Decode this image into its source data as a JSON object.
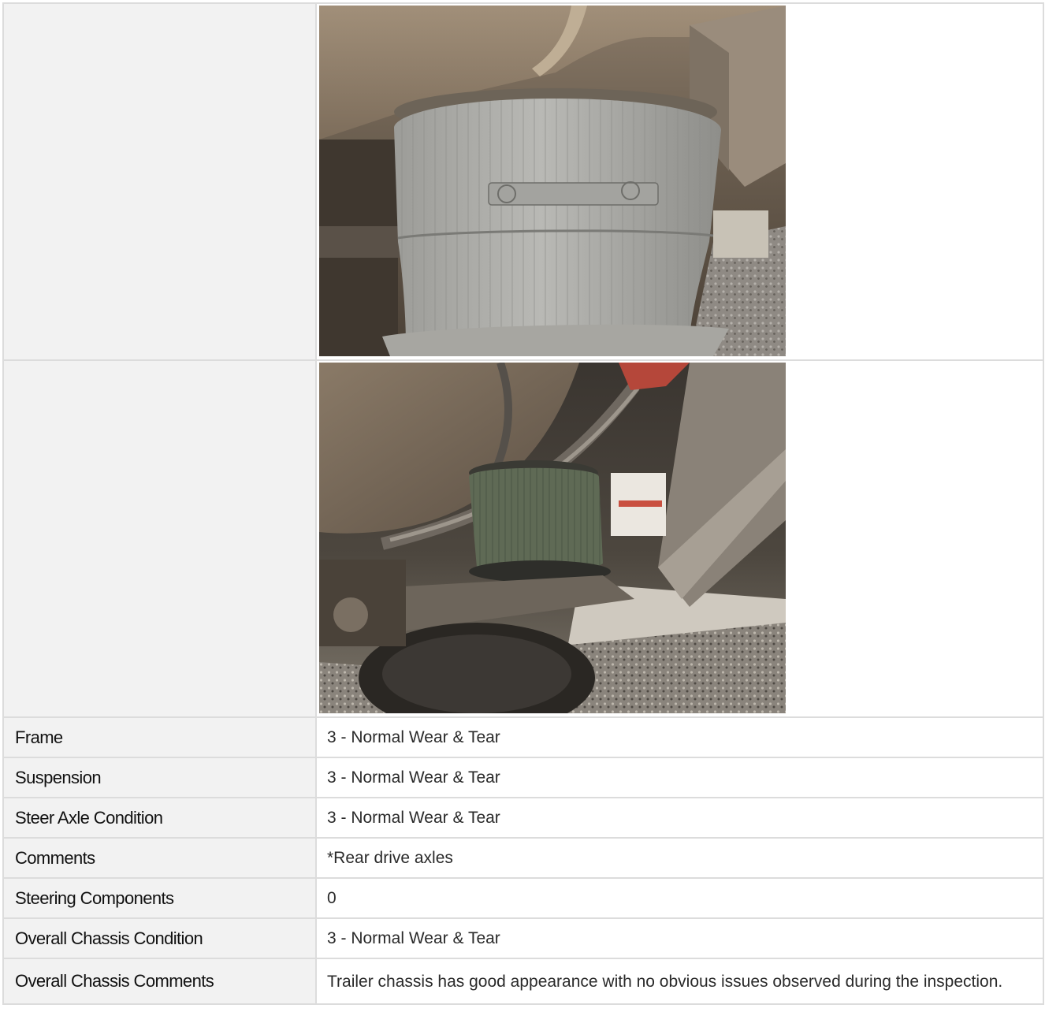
{
  "photos": [
    {
      "alt": "Air suspension bag under trailer chassis, close-up"
    },
    {
      "alt": "Air suspension bag and axle under trailer chassis"
    }
  ],
  "rows": [
    {
      "label": "Frame",
      "value": "3 - Normal Wear & Tear"
    },
    {
      "label": "Suspension",
      "value": "3 - Normal Wear & Tear"
    },
    {
      "label": "Steer Axle Condition",
      "value": "3 - Normal Wear & Tear"
    },
    {
      "label": "Comments",
      "value": "*Rear drive axles"
    },
    {
      "label": "Steering Components",
      "value": "0"
    },
    {
      "label": "Overall Chassis Condition",
      "value": "3 - Normal Wear & Tear"
    },
    {
      "label": "Overall Chassis Comments",
      "value": "Trailer chassis has good appearance with no obvious issues observed during the inspection."
    }
  ]
}
